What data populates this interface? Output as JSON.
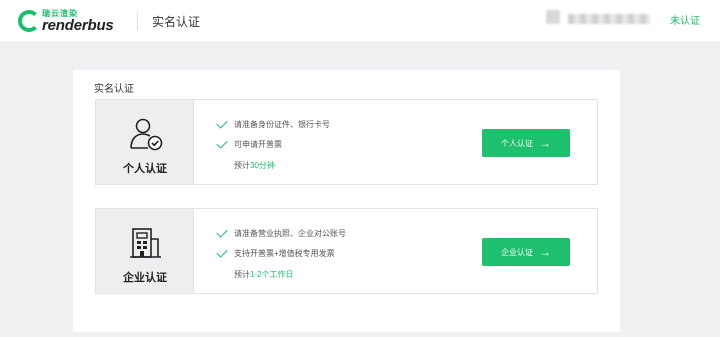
{
  "header": {
    "logo_top": "瑞云渲染",
    "logo_word": "renderbus",
    "page_name": "实名认证",
    "status": "未认证"
  },
  "panel": {
    "title": "实名认证",
    "cards": [
      {
        "title": "个人认证",
        "icon": "person-check-icon",
        "requirements": [
          "请准备身份证件、银行卡号",
          "可申请开普票"
        ],
        "eta_prefix": "预计",
        "eta_value": "30分钟",
        "button_label": "个人认证"
      },
      {
        "title": "企业认证",
        "icon": "building-icon",
        "requirements": [
          "请准备营业执照、企业对公账号",
          "支持开普票+增值税专用发票"
        ],
        "eta_prefix": "预计",
        "eta_value": "1-2个工作日",
        "button_label": "企业认证"
      }
    ]
  },
  "colors": {
    "accent": "#1bbf6a",
    "background": "#f0f0f2"
  }
}
